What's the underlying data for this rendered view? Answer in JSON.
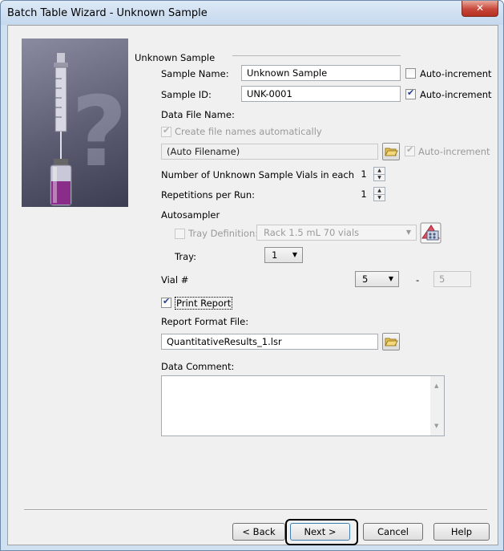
{
  "window": {
    "title": "Batch Table Wizard - Unknown Sample",
    "close_label": "✕"
  },
  "group": {
    "label": "Unknown Sample"
  },
  "sample_name": {
    "label": "Sample Name:",
    "value": "Unknown Sample",
    "autoinc_label": "Auto-increment",
    "autoinc_checked": false
  },
  "sample_id": {
    "label": "Sample ID:",
    "value": "UNK-0001",
    "autoinc_label": "Auto-increment",
    "autoinc_checked": true
  },
  "data_file": {
    "label": "Data File Name:",
    "create_auto_label": "Create file names automatically",
    "create_auto_checked": true,
    "value": "(Auto Filename)",
    "autoinc_label": "Auto-increment",
    "autoinc_checked": true
  },
  "vials_each": {
    "label": "Number of Unknown Sample Vials in each",
    "value": "1"
  },
  "repetitions": {
    "label": "Repetitions per Run:",
    "value": "1"
  },
  "autosampler": {
    "label": "Autosampler",
    "tray_def_label": "Tray Definition:",
    "tray_def_checked": false,
    "tray_def_value": "Rack 1.5 mL 70 vials",
    "tray_label": "Tray:",
    "tray_value": "1",
    "vial_label": "Vial #",
    "vial_from": "5",
    "vial_dash": "-",
    "vial_to": "5"
  },
  "report": {
    "print_label": "Print Report",
    "print_checked": true,
    "format_label": "Report Format File:",
    "format_value": "QuantitativeResults_1.lsr"
  },
  "comment": {
    "label": "Data Comment:",
    "value": ""
  },
  "buttons": {
    "back": "< Back",
    "next": "Next >",
    "cancel": "Cancel",
    "help": "Help"
  },
  "icons": {
    "folder": "folder-open-icon",
    "tray_editor": "tray-editor-icon"
  }
}
